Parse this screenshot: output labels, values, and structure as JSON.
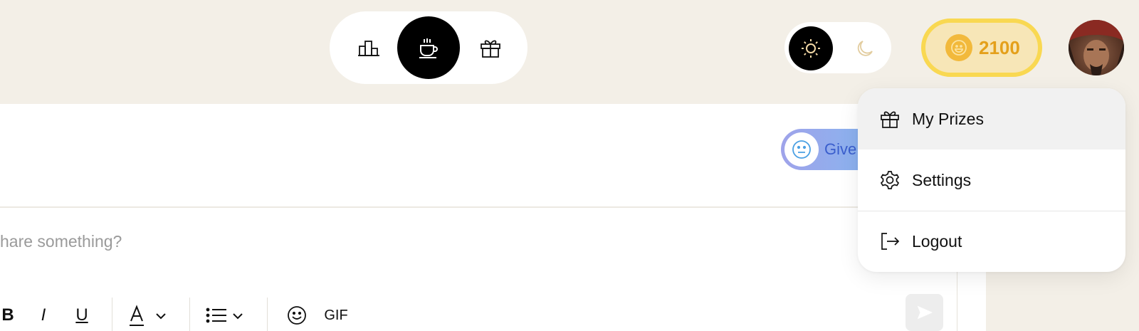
{
  "nav": {
    "items": [
      {
        "icon": "leaderboard-icon",
        "active": false
      },
      {
        "icon": "coffee-cup-icon",
        "active": true
      },
      {
        "icon": "gift-icon",
        "active": false
      }
    ]
  },
  "theme": {
    "options": [
      {
        "icon": "sun-icon",
        "active": true
      },
      {
        "icon": "moon-icon",
        "active": false
      }
    ]
  },
  "coins": {
    "icon": "coin-icon",
    "value": "2100",
    "color": "#e4a01b"
  },
  "user": {
    "avatar_icon": "avatar"
  },
  "give_button": {
    "icon": "neutral-face-icon",
    "label": "Give"
  },
  "composer": {
    "placeholder": "hare something?",
    "toolbar": {
      "bold_label": "B",
      "italic_label": "I",
      "underline_label": "U",
      "gif_label": "GIF"
    }
  },
  "menu": {
    "items": [
      {
        "icon": "gift-icon",
        "label": "My Prizes"
      },
      {
        "icon": "gear-icon",
        "label": "Settings"
      },
      {
        "icon": "logout-icon",
        "label": "Logout"
      }
    ]
  },
  "colors": {
    "background": "#f3efe7",
    "accent_yellow": "#f9d852",
    "give_text": "#3a5ecd"
  }
}
